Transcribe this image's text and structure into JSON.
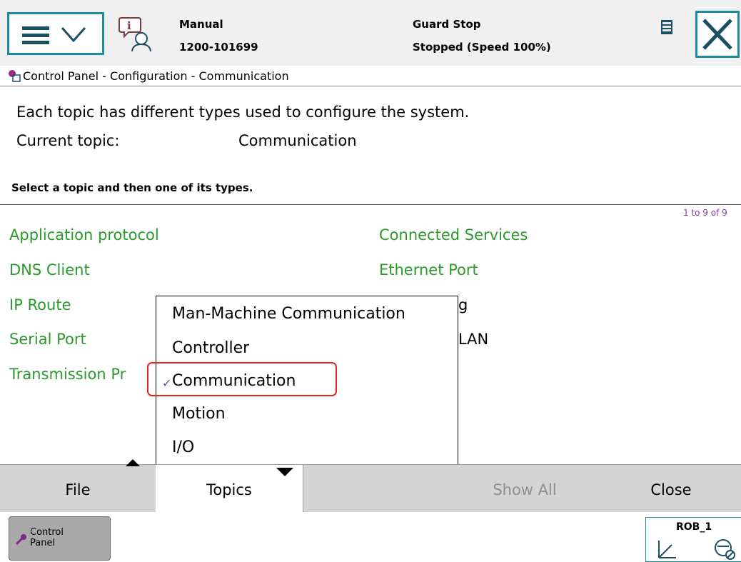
{
  "header": {
    "mode": "Manual",
    "system_id": "1200-101699",
    "guard_status": "Guard Stop",
    "run_status": "Stopped (Speed 100%)"
  },
  "title_bar": {
    "breadcrumb": "Control Panel - Configuration - Communication"
  },
  "info": {
    "description": "Each topic has different types used to configure the system.",
    "current_topic_label": "Current topic:",
    "current_topic_value": "Communication",
    "instruction": "Select a topic and then one of its types.",
    "count": "1 to 9 of 9"
  },
  "types": {
    "left": [
      "Application protocol",
      "DNS Client",
      "IP Route",
      "Serial Port",
      "Transmission Pr"
    ],
    "right": [
      "Connected Services",
      "Ethernet Port",
      "g",
      "LAN"
    ]
  },
  "topics_menu": {
    "items": [
      "Man-Machine Communication",
      "Controller",
      "Communication",
      "Motion",
      "I/O"
    ],
    "selected": "Communication",
    "check": "✓"
  },
  "bottom_bar": {
    "file": "File",
    "topics": "Topics",
    "show_all": "Show All",
    "close": "Close"
  },
  "taskbar": {
    "control_panel_line1": "Control",
    "control_panel_line2": "Panel",
    "robot": "ROB_1"
  },
  "colors": {
    "accent": "#1c8aa0",
    "type_link": "#2a9a2a",
    "highlight": "#e1251b",
    "count_text": "#7a3fa0"
  }
}
